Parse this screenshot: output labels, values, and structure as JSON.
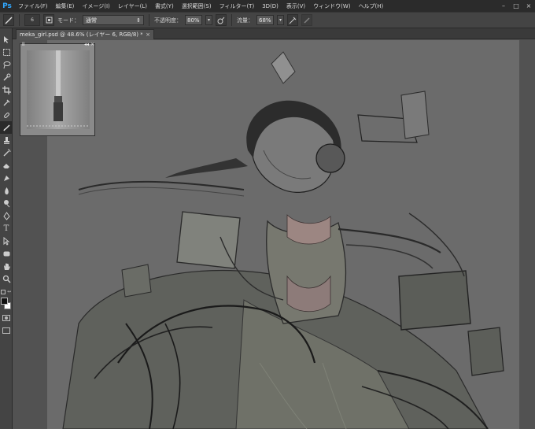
{
  "app": {
    "logo": "Ps"
  },
  "menu": [
    "ファイル(F)",
    "編集(E)",
    "イメージ(I)",
    "レイヤー(L)",
    "書式(Y)",
    "選択範囲(S)",
    "フィルター(T)",
    "3D(D)",
    "表示(V)",
    "ウィンドウ(W)",
    "ヘルプ(H)"
  ],
  "window_controls": {
    "minimize": "–",
    "maximize": "□",
    "close": "×"
  },
  "options": {
    "brush_size": "6",
    "mode_label": "モード：",
    "mode_value": "通常",
    "opacity_label": "不透明度：",
    "opacity_value": "80%",
    "flow_label": "流量：",
    "flow_value": "68%"
  },
  "document": {
    "tab_title": "meka_girl.psd @ 48.6% (レイヤー 6, RGB/8) *",
    "tab_close": "×"
  },
  "mini_panel": {
    "left_glyph": "II",
    "right_glyph": "◂◂ ×"
  },
  "tools": [
    "move-tool-icon",
    "marquee-tool-icon",
    "lasso-tool-icon",
    "quick-select-icon",
    "crop-tool-icon",
    "eyedropper-icon",
    "healing-brush-icon",
    "brush-tool-icon",
    "clone-stamp-icon",
    "history-brush-icon",
    "eraser-icon",
    "gradient-icon",
    "blur-icon",
    "dodge-icon",
    "pen-tool-icon",
    "type-tool-icon",
    "path-select-icon",
    "shape-tool-icon",
    "hand-tool-icon",
    "zoom-tool-icon"
  ],
  "type_tool_glyph": "T",
  "colors": {
    "ui_dark": "#2b2b2b",
    "panel": "#444444",
    "canvas": "#6c6c6c",
    "accent": "#31a8ff"
  }
}
